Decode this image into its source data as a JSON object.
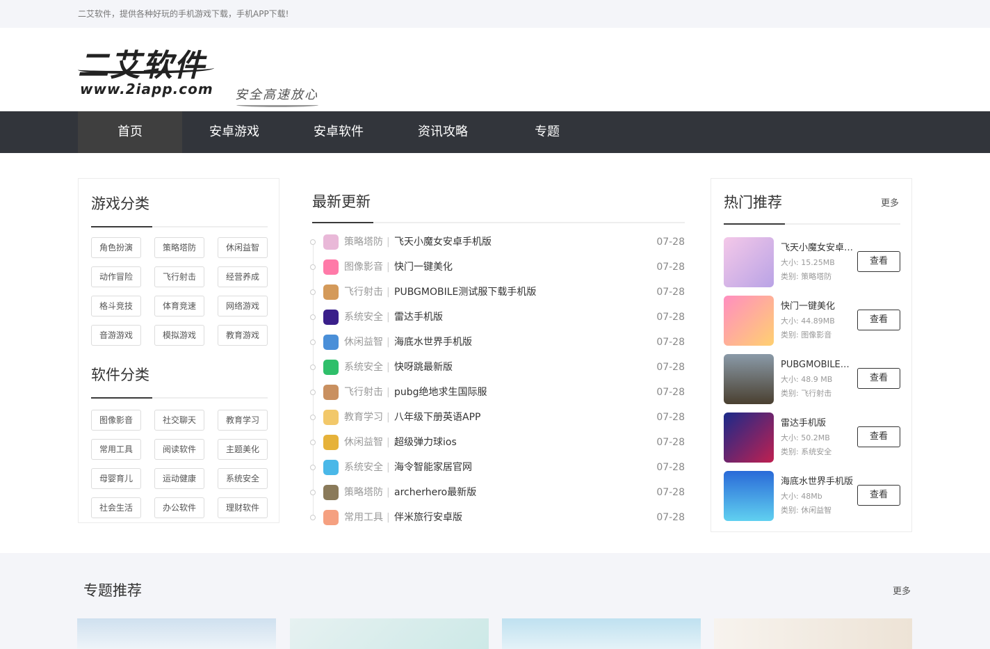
{
  "topbar": {
    "text": "二艾软件，提供各种好玩的手机游戏下载，手机APP下载!"
  },
  "logo": {
    "cn": "二艾软件",
    "en": "www.2iapp.com"
  },
  "slogan": "安全高速放心",
  "nav": {
    "items": [
      "首页",
      "安卓游戏",
      "安卓软件",
      "资讯攻略",
      "专题"
    ]
  },
  "game_categories": {
    "title": "游戏分类",
    "tags": [
      "角色扮演",
      "策略塔防",
      "休闲益智",
      "动作冒险",
      "飞行射击",
      "经营养成",
      "格斗竞技",
      "体育竞速",
      "网络游戏",
      "音游游戏",
      "模拟游戏",
      "教育游戏"
    ]
  },
  "software_categories": {
    "title": "软件分类",
    "tags": [
      "图像影音",
      "社交聊天",
      "教育学习",
      "常用工具",
      "阅读软件",
      "主题美化",
      "母婴育儿",
      "运动健康",
      "系统安全",
      "社会生活",
      "办公软件",
      "理财软件"
    ]
  },
  "latest": {
    "title": "最新更新",
    "items": [
      {
        "cat": "策略塔防",
        "name": "飞天小魔女安卓手机版",
        "date": "07-28"
      },
      {
        "cat": "图像影音",
        "name": "快门一键美化",
        "date": "07-28"
      },
      {
        "cat": "飞行射击",
        "name": "PUBGMOBILE测试服下载手机版",
        "date": "07-28"
      },
      {
        "cat": "系统安全",
        "name": "雷达手机版",
        "date": "07-28"
      },
      {
        "cat": "休闲益智",
        "name": "海底水世界手机版",
        "date": "07-28"
      },
      {
        "cat": "系统安全",
        "name": "快呀跳最新版",
        "date": "07-28"
      },
      {
        "cat": "飞行射击",
        "name": "pubg绝地求生国际服",
        "date": "07-28"
      },
      {
        "cat": "教育学习",
        "name": "八年级下册英语APP",
        "date": "07-28"
      },
      {
        "cat": "休闲益智",
        "name": "超级弹力球ios",
        "date": "07-28"
      },
      {
        "cat": "系统安全",
        "name": "海令智能家居官网",
        "date": "07-28"
      },
      {
        "cat": "策略塔防",
        "name": "archerhero最新版",
        "date": "07-28"
      },
      {
        "cat": "常用工具",
        "name": "伴米旅行安卓版",
        "date": "07-28"
      }
    ]
  },
  "hot": {
    "title": "热门推荐",
    "more": "更多",
    "size_prefix": "大小:",
    "cat_prefix": "类别:",
    "button": "查看",
    "items": [
      {
        "name": "飞天小魔女安卓手机版",
        "size": "15.25MB",
        "cat": "策略塔防"
      },
      {
        "name": "快门一键美化",
        "size": "44.89MB",
        "cat": "图像影音"
      },
      {
        "name": "PUBGMOBILE测试服",
        "size": "48.9 MB",
        "cat": "飞行射击"
      },
      {
        "name": "雷达手机版",
        "size": "50.2MB",
        "cat": "系统安全"
      },
      {
        "name": "海底水世界手机版",
        "size": "48Mb",
        "cat": "休闲益智"
      }
    ]
  },
  "topics": {
    "title": "专题推荐",
    "more": "更多"
  },
  "colors": {
    "nav_bg": "#32353b",
    "nav_active": "#3f3f3f",
    "accent_green": "#1aa05a",
    "page_gray": "#f4f5f9"
  }
}
